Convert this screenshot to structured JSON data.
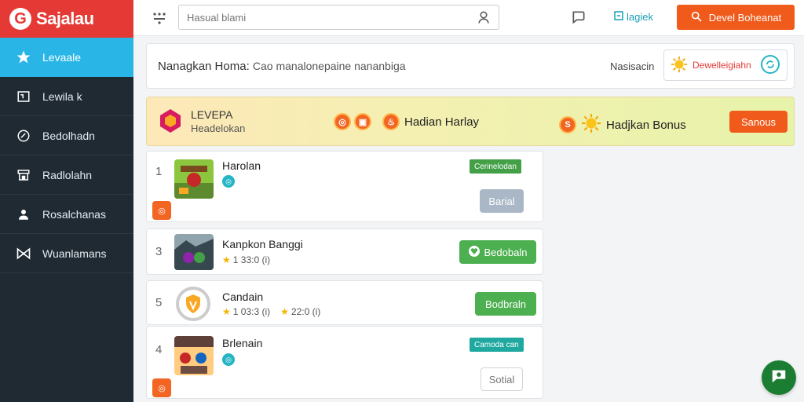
{
  "brand": {
    "name": "Sajalau",
    "mark": "G"
  },
  "sidebar": {
    "items": [
      {
        "label": "Levaale",
        "icon": "star-icon",
        "active": true
      },
      {
        "label": "Lewila k",
        "icon": "box-icon"
      },
      {
        "label": "Bedolhadn",
        "icon": "dial-icon"
      },
      {
        "label": "Radlolahn",
        "icon": "store-icon"
      },
      {
        "label": "Rosalchanas",
        "icon": "user-icon"
      },
      {
        "label": "Wuanlamans",
        "icon": "bow-icon"
      }
    ]
  },
  "topbar": {
    "search_placeholder": "Hasual blami",
    "login_label": "lagiek",
    "cta_label": "Devel Boheanat"
  },
  "heading": {
    "title": "Nanagkan Homa:",
    "subtitle": "Cao manalonepaine nananbiga",
    "side_label": "Nasisacin",
    "badge_label": "Dewelleigiahn"
  },
  "level_banner": {
    "title": "LEVEPA",
    "subtitle": "Headelokan",
    "daily_label": "Hadian Harlay",
    "bonus_label": "Hadjkan Bonus",
    "bonus_coin": "S",
    "button_label": "Sanous"
  },
  "rows": [
    {
      "rank": "1",
      "name": "Harolan",
      "tag": "Cerinelodan",
      "button": "Barial"
    },
    {
      "rank": "3",
      "name": "Kanpkon Banggi",
      "rating": "1 33:0 (i)",
      "button": "Bedobaln"
    },
    {
      "rank": "5",
      "name": "Candain",
      "rating": "1 03:3 (i)",
      "rating2": "22:0 (i)",
      "button": "Bodbraln"
    },
    {
      "rank": "4",
      "name": "Brlenain",
      "tag": "Camoda can",
      "button": "Sotial"
    }
  ],
  "colors": {
    "brand_red": "#e53935",
    "sidebar_bg": "#1f2a33",
    "active_blue": "#29b6e6",
    "cta_orange": "#f05a1a",
    "green": "#4caf50"
  }
}
